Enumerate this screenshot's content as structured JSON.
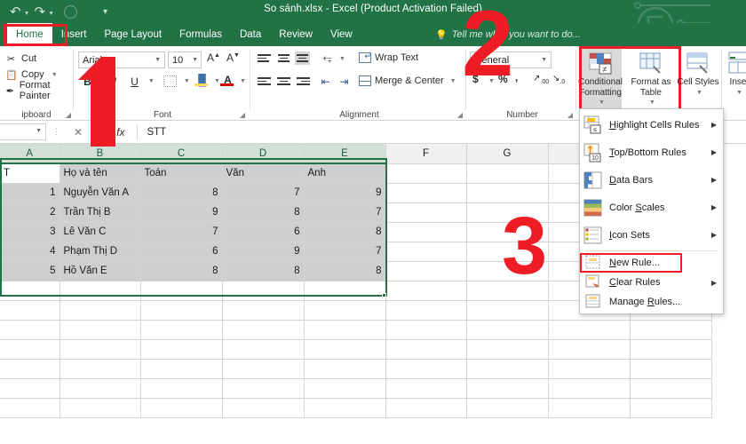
{
  "window": {
    "title": "So sánh.xlsx - Excel (Product Activation Failed)"
  },
  "quick_access": {
    "undo_icon": "undo-icon",
    "redo_icon": "redo-icon",
    "save_icon": "save-circle-icon",
    "customize_icon": "customize-qat-icon"
  },
  "ribbon": {
    "tabs": [
      {
        "label": "Home",
        "active": true
      },
      {
        "label": "Insert",
        "active": false
      },
      {
        "label": "Page Layout",
        "active": false
      },
      {
        "label": "Formulas",
        "active": false
      },
      {
        "label": "Data",
        "active": false
      },
      {
        "label": "Review",
        "active": false
      },
      {
        "label": "View",
        "active": false
      }
    ],
    "tell_me": "Tell me what you want to do...",
    "groups": {
      "clipboard": {
        "label": "ipboard",
        "items": [
          {
            "label": "Cut",
            "icon": "scissors-icon"
          },
          {
            "label": "Copy",
            "icon": "copy-icon"
          },
          {
            "label": "Format Painter",
            "icon": "format-painter-icon"
          }
        ]
      },
      "font": {
        "label": "Font",
        "font_name": "Arial",
        "font_size": "10",
        "grow_label": "A",
        "shrink_label": "A",
        "bold_label": "B",
        "italic_label": "I",
        "underline_label": "U"
      },
      "alignment": {
        "label": "Alignment",
        "wrap_text": "Wrap Text",
        "merge_center": "Merge & Center"
      },
      "number": {
        "label": "Number",
        "format": "General",
        "currency_label": "$",
        "percent_label": "%",
        "comma_label": ","
      },
      "styles": {
        "conditional_formatting": "Conditional Formatting",
        "format_as_table": "Format as Table",
        "cell_styles": "Cell Styles"
      },
      "cells": {
        "insert": "Inse"
      }
    }
  },
  "formula_bar": {
    "name_box": "",
    "cancel_icon": "cancel-icon",
    "enter_icon": "enter-icon",
    "fx_label": "fx",
    "value": "STT"
  },
  "menu": {
    "items": [
      {
        "label": "Highlight Cells Rules",
        "underline": "H",
        "icon": "highlight-cells-icon",
        "submenu": true
      },
      {
        "label": "Top/Bottom Rules",
        "underline": "T",
        "icon": "top-bottom-icon",
        "submenu": true
      },
      {
        "label": "Data Bars",
        "underline": "D",
        "icon": "data-bars-icon",
        "submenu": true
      },
      {
        "label": "Color Scales",
        "underline": "S",
        "icon": "color-scales-icon",
        "submenu": true
      },
      {
        "label": "Icon Sets",
        "underline": "I",
        "icon": "icon-sets-icon",
        "submenu": true
      },
      {
        "label": "New Rule...",
        "underline": "N",
        "icon": "new-rule-icon",
        "submenu": false,
        "highlighted": true
      },
      {
        "label": "Clear Rules",
        "underline": "C",
        "icon": "clear-rules-icon",
        "submenu": true
      },
      {
        "label": "Manage Rules...",
        "underline": "R",
        "icon": "manage-rules-icon",
        "submenu": false
      }
    ]
  },
  "sheet": {
    "columns": [
      "A",
      "B",
      "C",
      "D",
      "E",
      "F",
      "G"
    ],
    "selected_columns": [
      "A",
      "B",
      "C",
      "D",
      "E"
    ],
    "header_row": [
      "T",
      "Họ và tên",
      "Toán",
      "Văn",
      "Anh"
    ],
    "rows": [
      {
        "stt": "1",
        "name": "Nguyễn Văn A",
        "toan": "8",
        "van": "7",
        "anh": "9"
      },
      {
        "stt": "2",
        "name": "Trần Thị B",
        "toan": "9",
        "van": "8",
        "anh": "7"
      },
      {
        "stt": "3",
        "name": "Lê Văn C",
        "toan": "7",
        "van": "6",
        "anh": "8"
      },
      {
        "stt": "4",
        "name": "Phạm Thị D",
        "toan": "6",
        "van": "9",
        "anh": "7"
      },
      {
        "stt": "5",
        "name": "Hồ Văn E",
        "toan": "8",
        "van": "8",
        "anh": "8"
      }
    ]
  },
  "annotations": {
    "step1": "1",
    "step2": "2",
    "step3": "3"
  },
  "colors": {
    "excel_green": "#217346",
    "annotation_red": "#ee1c25",
    "selection_fill": "#cfcfcf"
  }
}
